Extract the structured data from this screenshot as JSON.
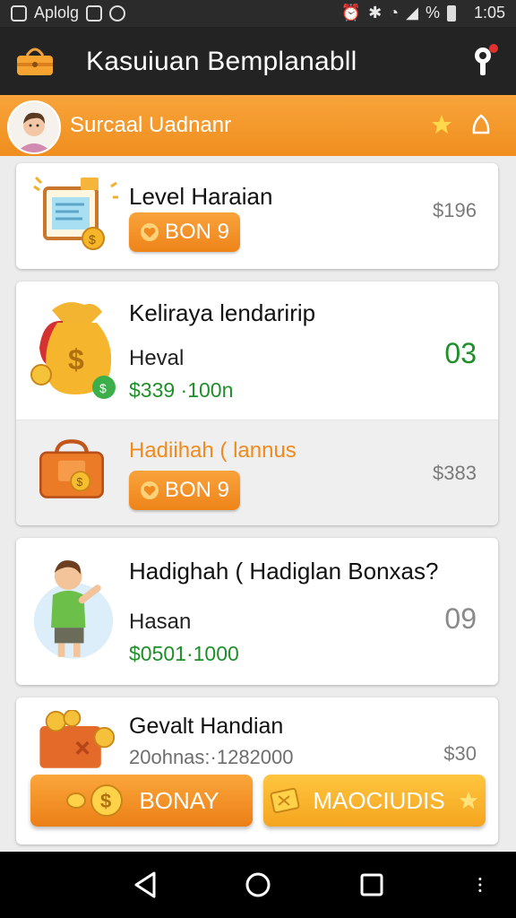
{
  "status_bar": {
    "app_label": "Aplolg",
    "battery_percent": "%",
    "time": "1:05"
  },
  "app_bar": {
    "title": "Kasuiuan Bemplanabll"
  },
  "user_bar": {
    "name": "Surcaal Uadnanr"
  },
  "cards": [
    {
      "title": "Level Haraian",
      "amount": "$196",
      "button_label": "BON 9"
    },
    {
      "top": {
        "title": "Keliraya lendaririp",
        "subtitle": "Heval",
        "value": "$339 ·100n",
        "count": "03"
      },
      "bottom": {
        "title": "Hadiihah ( lannus",
        "amount": "$383",
        "button_label": "BON 9"
      }
    },
    {
      "title": "Hadighah ( Hadiglan Bonxas?",
      "subtitle": "Hasan",
      "value": "$0501·1000",
      "count": "09"
    },
    {
      "title": "Gevalt Handian",
      "subtitle": "20ohnas:·1282000",
      "amount": "$30"
    }
  ],
  "actions": {
    "primary_label": "BONAY",
    "secondary_label": "MAOCIUDIS"
  },
  "colors": {
    "accent": "#F39A2B",
    "green": "#1F8F2A",
    "bar": "#232323"
  }
}
